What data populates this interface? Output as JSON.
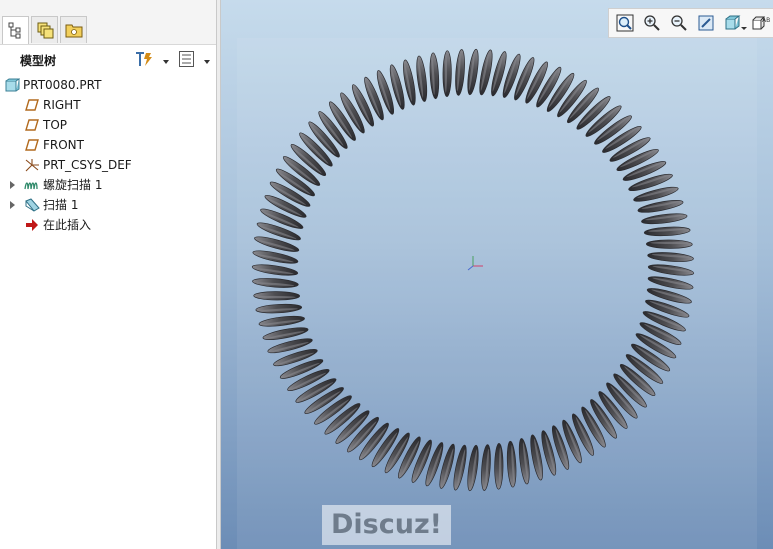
{
  "sidebar": {
    "tabs": [
      {
        "name": "model-tree-tab",
        "icon": "tree-structure-icon"
      },
      {
        "name": "layers-tab",
        "icon": "layers-icon"
      },
      {
        "name": "folder-tab",
        "icon": "folder-icon"
      }
    ],
    "model_tree": {
      "title": "模型树",
      "settings_icon": "tree-settings-icon",
      "columns_icon": "tree-columns-icon",
      "items": [
        {
          "label": "PRT0080.PRT",
          "icon": "part-icon",
          "expandable": false
        },
        {
          "label": "RIGHT",
          "icon": "datum-plane-icon",
          "expandable": false
        },
        {
          "label": "TOP",
          "icon": "datum-plane-icon",
          "expandable": false
        },
        {
          "label": "FRONT",
          "icon": "datum-plane-icon",
          "expandable": false
        },
        {
          "label": "PRT_CSYS_DEF",
          "icon": "coordinate-system-icon",
          "expandable": false
        },
        {
          "label": "螺旋扫描 1",
          "icon": "helical-sweep-icon",
          "expandable": true
        },
        {
          "label": "扫描 1",
          "icon": "sweep-icon",
          "expandable": true
        },
        {
          "label": "在此插入",
          "icon": "insert-here-arrow-icon",
          "expandable": false
        }
      ]
    }
  },
  "viewport": {
    "toolbar": [
      {
        "name": "refit-button",
        "icon": "zoom-fit-icon"
      },
      {
        "name": "zoom-in-button",
        "icon": "zoom-in-icon"
      },
      {
        "name": "zoom-out-button",
        "icon": "zoom-out-icon"
      },
      {
        "name": "repaint-button",
        "icon": "repaint-icon"
      },
      {
        "name": "display-style-button",
        "icon": "shaded-cube-icon"
      },
      {
        "name": "saved-orientations-button",
        "icon": "named-views-icon"
      }
    ],
    "model": {
      "name": "coil-spring-ring",
      "coil_count": 96,
      "colors": {
        "coil": "#4e4e52",
        "coil_highlight": "#8a8a90",
        "coil_shadow": "#2a2a2e"
      }
    },
    "watermark": "Discuz!"
  },
  "colors": {
    "background_top": "#c6dbec",
    "background_bottom": "#6c8db6",
    "datum_plane": "#b26a1e",
    "insert_arrow": "#c01818",
    "part_icon": "#7fc6d8"
  }
}
